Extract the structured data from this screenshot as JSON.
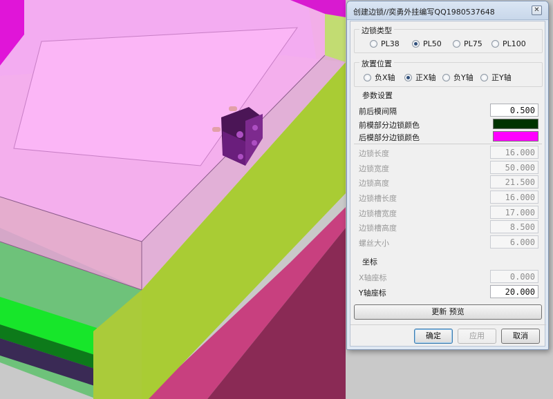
{
  "dialog": {
    "title": "创建边锁//奕勇外挂编写QQ1980537648",
    "close_glyph": "✕"
  },
  "lock_type": {
    "title": "边锁类型",
    "options": [
      "PL38",
      "PL50",
      "PL75",
      "PL100"
    ],
    "selected": "PL50"
  },
  "placement": {
    "title": "放置位置",
    "options": [
      "负X轴",
      "正X轴",
      "负Y轴",
      "正Y轴"
    ],
    "selected": "正X轴"
  },
  "params": {
    "title": "参数设置",
    "gap_label": "前后模间隔",
    "gap_value": "0.500",
    "front_color_label": "前模部分边锁颜色",
    "front_color": "#003300",
    "rear_color_label": "后模部分边锁颜色",
    "rear_color": "#ff00ff",
    "disabled_rows": [
      {
        "label": "边锁长度",
        "value": "16.000"
      },
      {
        "label": "边锁宽度",
        "value": "50.000"
      },
      {
        "label": "边锁高度",
        "value": "21.500"
      },
      {
        "label": "边锁槽长度",
        "value": "16.000"
      },
      {
        "label": "边锁槽宽度",
        "value": "17.000"
      },
      {
        "label": "边锁槽高度",
        "value": "8.500"
      },
      {
        "label": "螺丝大小",
        "value": "6.000"
      }
    ]
  },
  "coords": {
    "title": "坐标",
    "x_label": "X轴座标",
    "x_value": "0.000",
    "y_label": "Y轴座标",
    "y_value": "20.000"
  },
  "buttons": {
    "update_preview": "更新    预览",
    "ok": "确定",
    "apply": "应用",
    "cancel": "取消"
  },
  "colors": {
    "mold_magenta": "#f79df5",
    "mold_green": "#b2cf45",
    "lock_purple": "#6a1e7c"
  }
}
